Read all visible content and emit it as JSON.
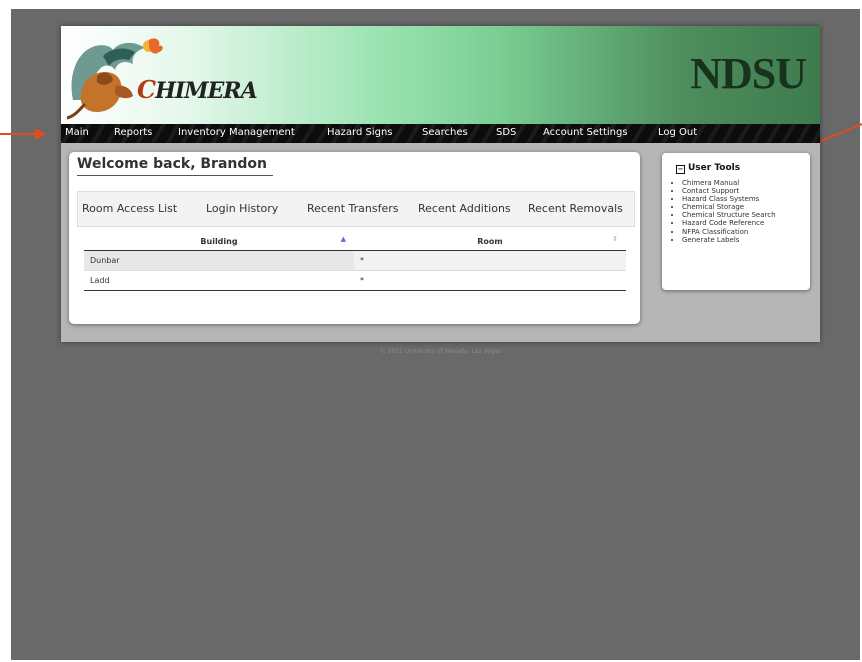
{
  "brand": {
    "logo_text_initial": "C",
    "logo_text_rest": "HIMERA",
    "school": "NDSU"
  },
  "nav": {
    "items": [
      "Main",
      "Reports",
      "Inventory Management",
      "Hazard Signs",
      "Searches",
      "SDS",
      "Account Settings",
      "Log Out"
    ]
  },
  "welcome": {
    "heading": "Welcome back, Brandon",
    "tabs": [
      "Room Access List",
      "Login History",
      "Recent Transfers",
      "Recent Additions",
      "Recent Removals"
    ],
    "table": {
      "columns": [
        "Building",
        "Room"
      ],
      "sort_glyphs": [
        "▲",
        "⇕"
      ],
      "rows": [
        [
          "Dunbar",
          "*"
        ],
        [
          "Ladd",
          "*"
        ]
      ]
    }
  },
  "tools": {
    "title": "User Tools",
    "toggle_glyph": "−",
    "links": [
      "Chimera Manual",
      "Contact Support",
      "Hazard Class Systems",
      "Chemical Storage",
      "Chemical Structure Search",
      "Hazard Code Reference",
      "NFPA Classification",
      "Generate Labels"
    ]
  },
  "footer": {
    "text": "© 2021 University of Nevada, Las Vegas"
  },
  "colors": {
    "annotation_arrow": "#e24a1f",
    "banner_green": "#3e7b4e",
    "navbar": "#0c0c0c",
    "backdrop": "#696969"
  }
}
